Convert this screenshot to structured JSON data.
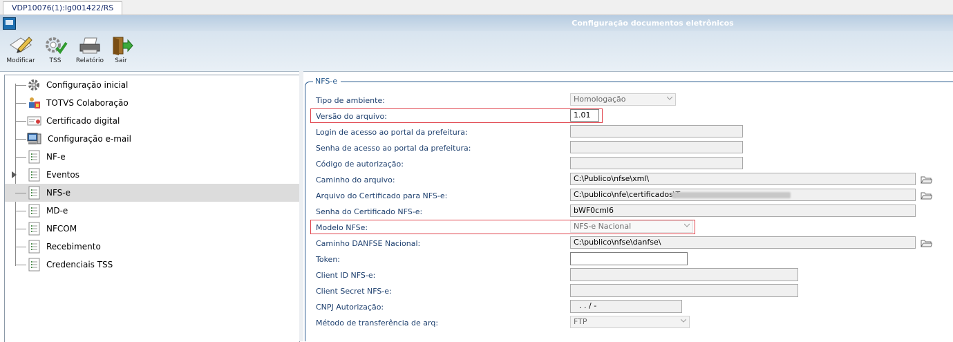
{
  "session_tab": "VDP10076(1):lg001422/RS",
  "window_title": "Configuração documentos eletrônicos",
  "toolbar": {
    "buttons": [
      {
        "label": "Modificar",
        "icon": "edit-pencil-icon"
      },
      {
        "label": "TSS",
        "icon": "gear-check-icon"
      },
      {
        "label": "Relatório",
        "icon": "printer-icon"
      },
      {
        "label": "Sair",
        "icon": "exit-door-icon"
      }
    ]
  },
  "tree": {
    "items": [
      {
        "label": "Configuração inicial",
        "icon": "gear-icon"
      },
      {
        "label": "TOTVS Colaboração",
        "icon": "collaboration-icon"
      },
      {
        "label": "Certificado digital",
        "icon": "certificate-icon"
      },
      {
        "label": "Configuração e-mail",
        "icon": "computer-icon"
      },
      {
        "label": "NF-e",
        "icon": "document-list-icon"
      },
      {
        "label": "Eventos",
        "icon": "document-list-icon"
      },
      {
        "label": "NFS-e",
        "icon": "document-list-icon"
      },
      {
        "label": "MD-e",
        "icon": "document-list-icon"
      },
      {
        "label": "NFCOM",
        "icon": "document-list-icon"
      },
      {
        "label": "Recebimento",
        "icon": "document-list-icon"
      },
      {
        "label": "Credenciais TSS",
        "icon": "document-list-icon"
      }
    ],
    "selected": "NFS-e"
  },
  "form": {
    "group_title": "NFS-e",
    "fields": {
      "tipo_ambiente": {
        "label": "Tipo de ambiente:",
        "value": "Homologação"
      },
      "versao_arquivo": {
        "label": "Versão do arquivo:",
        "value": "1.01"
      },
      "login_portal": {
        "label": "Login de acesso ao portal da prefeitura:",
        "value": ""
      },
      "senha_portal": {
        "label": "Senha de acesso ao portal da prefeitura:",
        "value": ""
      },
      "codigo_autorizacao": {
        "label": "Código de autorização:",
        "value": ""
      },
      "caminho_arquivo": {
        "label": "Caminho do arquivo:",
        "value": "C:\\Publico\\nfse\\xml\\"
      },
      "arquivo_certificado": {
        "label": "Arquivo do Certificado para NFS-e:",
        "value": "C:\\publico\\nfe\\certificados\\T"
      },
      "senha_certificado": {
        "label": "Senha do Certificado NFS-e:",
        "value": "bWF0cml6"
      },
      "modelo_nfse": {
        "label": "Modelo NFSe:",
        "value": "NFS-e Nacional"
      },
      "caminho_danfse": {
        "label": "Caminho DANFSE Nacional:",
        "value": "C:\\publico\\nfse\\danfse\\"
      },
      "token": {
        "label": "Token:",
        "value": ""
      },
      "client_id": {
        "label": "Client ID NFS-e:",
        "value": ""
      },
      "client_secret": {
        "label": "Client Secret NFS-e:",
        "value": ""
      },
      "cnpj_autorizacao": {
        "label": "CNPJ Autorização:",
        "value": ".  .  /  -"
      },
      "metodo_transferencia": {
        "label": "Método de transferência de arq:",
        "value": "FTP"
      }
    }
  },
  "colors": {
    "title_gradient_top": "#b7cce1",
    "label_text": "#1d3f6e",
    "group_border": "#23568b",
    "highlight_border": "#e0434c",
    "selected_row": "#dcdcdc"
  }
}
